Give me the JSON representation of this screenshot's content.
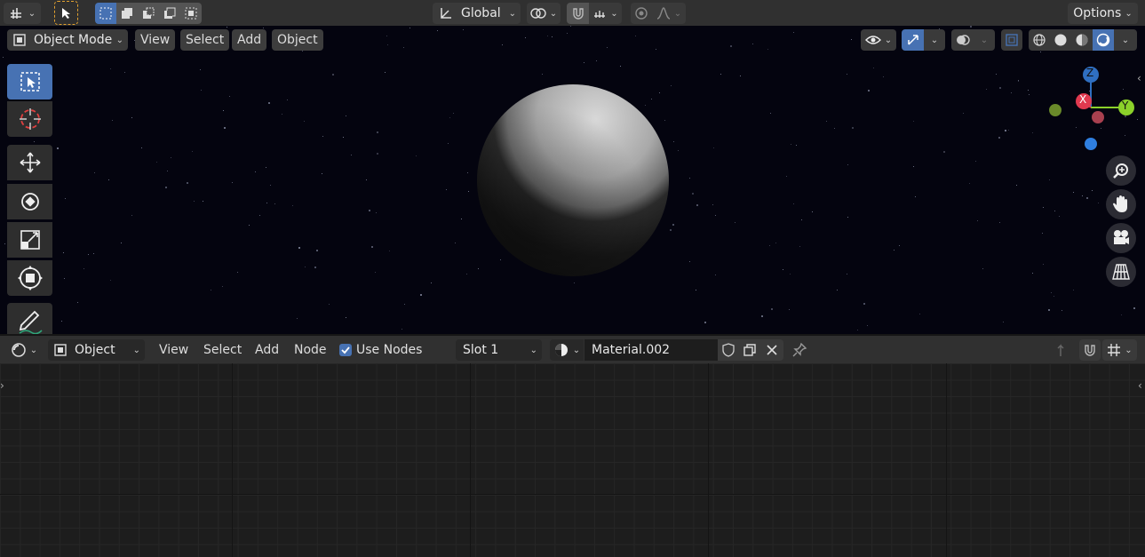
{
  "top_header": {
    "transform_orientation": "Global",
    "options_label": "Options"
  },
  "viewport_header": {
    "mode_label": "Object Mode",
    "menus": [
      "View",
      "Select",
      "Add",
      "Object"
    ]
  },
  "gizmo": {
    "x": "X",
    "y": "Y",
    "z": "Z"
  },
  "node_header": {
    "editor_label": "Object",
    "menus": [
      "View",
      "Select",
      "Add",
      "Node"
    ],
    "use_nodes_label": "Use Nodes",
    "use_nodes_checked": true,
    "slot_label": "Slot 1",
    "material_name": "Material.002"
  },
  "colors": {
    "accent": "#4772b3",
    "axis_x": "#e0394f",
    "axis_y": "#8bd12a",
    "axis_z": "#2f6fc1",
    "viewport_bg": "#04040f"
  }
}
